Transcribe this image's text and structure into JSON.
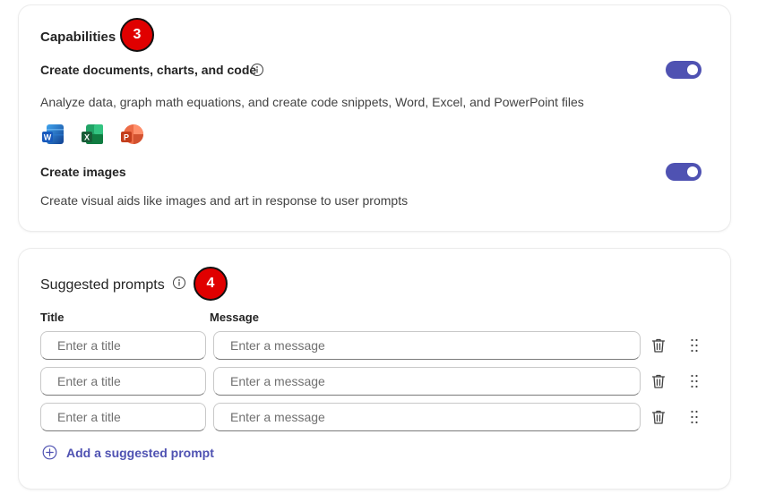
{
  "capabilities": {
    "title": "Capabilities",
    "step_badge": "3",
    "items": [
      {
        "title": "Create documents, charts, and code",
        "description": "Analyze data, graph math equations, and create code snippets, Word, Excel, and PowerPoint files",
        "enabled": true,
        "app_icons": [
          "word-icon",
          "excel-icon",
          "powerpoint-icon"
        ]
      },
      {
        "title": "Create images",
        "description": "Create visual aids like images and art in response to user prompts",
        "enabled": true
      }
    ]
  },
  "suggested_prompts": {
    "title": "Suggested prompts",
    "step_badge": "4",
    "columns": {
      "title": "Title",
      "message": "Message"
    },
    "rows": [
      {
        "title_placeholder": "Enter a title",
        "message_placeholder": "Enter a message",
        "title_value": "",
        "message_value": ""
      },
      {
        "title_placeholder": "Enter a title",
        "message_placeholder": "Enter a message",
        "title_value": "",
        "message_value": ""
      },
      {
        "title_placeholder": "Enter a title",
        "message_placeholder": "Enter a message",
        "title_value": "",
        "message_value": ""
      }
    ],
    "add_label": "Add a suggested prompt"
  },
  "colors": {
    "accent": "#4f52b2",
    "badge": "#e00000"
  }
}
